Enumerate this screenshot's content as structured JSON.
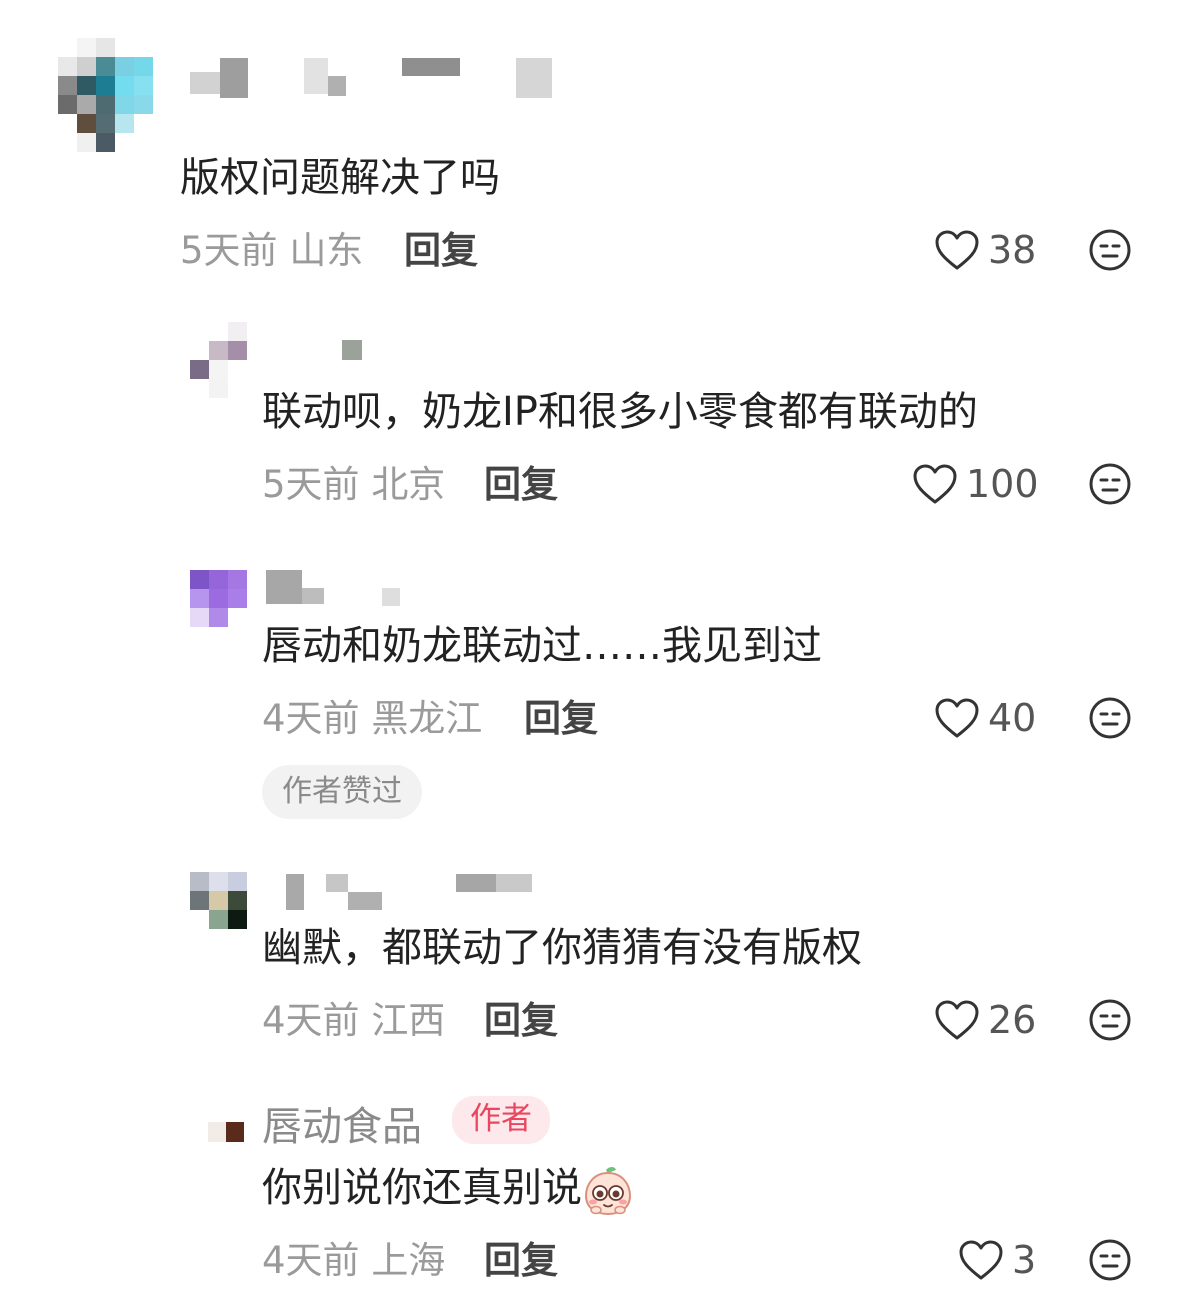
{
  "comments": [
    {
      "content": "版权问题解决了吗",
      "time": "5天前",
      "location": "山东",
      "reply_label": "回复",
      "likes": "38"
    },
    {
      "content": "联动呗，奶龙IP和很多小零食都有联动的",
      "time": "5天前",
      "location": "北京",
      "reply_label": "回复",
      "likes": "100"
    },
    {
      "content": "唇动和奶龙联动过……我见到过",
      "time": "4天前",
      "location": "黑龙江",
      "reply_label": "回复",
      "likes": "40",
      "tag": "作者赞过"
    },
    {
      "content": "幽默，都联动了你猜猜有没有版权",
      "time": "4天前",
      "location": "江西",
      "reply_label": "回复",
      "likes": "26"
    },
    {
      "name": "唇动食品",
      "badge": "作者",
      "content": "你别说你还真别说",
      "time": "4天前",
      "location": "上海",
      "reply_label": "回复",
      "likes": "3"
    }
  ],
  "icons": {
    "like": "heart-outline-icon",
    "dislike": "neutral-face-icon",
    "sticker": "peach-sticker-icon"
  },
  "colors": {
    "text": "#222222",
    "meta": "#9a9a9a",
    "badge_bg": "#fde9ec",
    "badge_text": "#e8475f",
    "tag_bg": "#f2f2f2"
  }
}
